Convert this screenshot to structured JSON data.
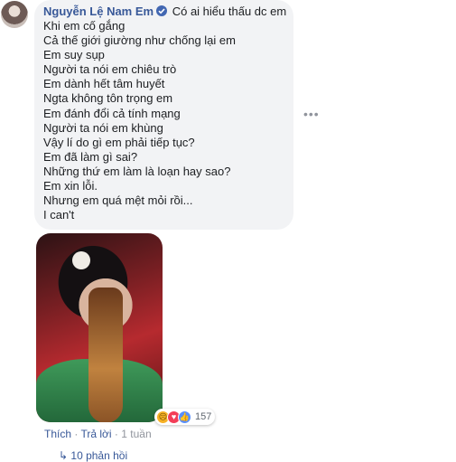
{
  "comment": {
    "author": "Nguyễn Lệ Nam Em",
    "first_line": "Có ai hiểu thấu dc em",
    "lines": [
      "Khi em cố gắng",
      "Cả thế giới giường như chống lại em",
      "Em suy sụp",
      "Người ta nói em chiêu trò",
      "Em dành hết tâm huyết",
      "Ngta không tôn trọng em",
      "Em đánh đổi cả tính mạng",
      "Người ta nói em khùng",
      "Vậy lí do gì em phải tiếp tục?",
      "Em đã làm gì sai?",
      "Những thứ em làm là loạn hay sao?",
      "Em xin lỗi.",
      "Nhưng em quá mệt mỏi rồi...",
      "I can't"
    ],
    "more_icon": "ellipsis-icon",
    "reactions": {
      "icons": [
        "sad-icon",
        "love-icon",
        "like-icon"
      ],
      "count": "157"
    },
    "actions": {
      "like": "Thích",
      "reply": "Trả lời",
      "time": "1 tuần"
    },
    "replies_label": "↳ 10 phản hồi"
  },
  "colors": {
    "link": "#385898",
    "bubble": "#f2f3f5",
    "meta": "#90949c"
  }
}
